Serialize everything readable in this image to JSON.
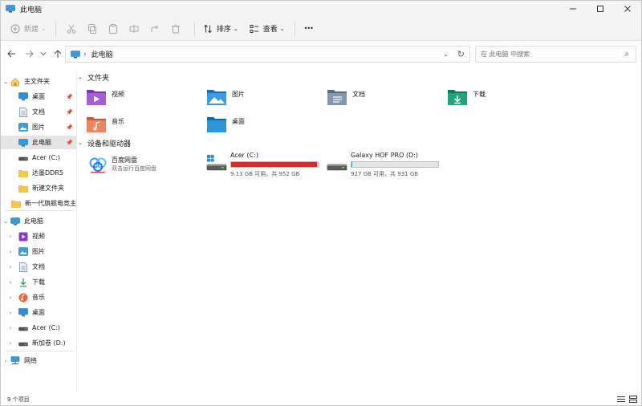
{
  "window": {
    "title": "此电脑"
  },
  "toolbar": {
    "new_label": "新建",
    "sort_label": "排序",
    "view_label": "查看",
    "more_label": "•••"
  },
  "address": {
    "path": "此电脑",
    "search_placeholder": "在 此电脑 中搜索"
  },
  "sidebar": {
    "home": "主文件夹",
    "quick": [
      {
        "label": "桌面",
        "icon": "desktop-icon",
        "pinned": true
      },
      {
        "label": "文档",
        "icon": "document-icon",
        "pinned": true
      },
      {
        "label": "图片",
        "icon": "picture-icon",
        "pinned": true
      },
      {
        "label": "此电脑",
        "icon": "pc-icon",
        "pinned": true
      },
      {
        "label": "Acer (C:)",
        "icon": "drive-icon",
        "pinned": false
      },
      {
        "label": "达墨DDR5",
        "icon": "folder-icon",
        "pinned": false
      },
      {
        "label": "新建文件夹",
        "icon": "folder-icon",
        "pinned": false
      },
      {
        "label": "新一代旗舰电竞主",
        "icon": "folder-icon",
        "pinned": false
      }
    ],
    "pc": "此电脑",
    "pc_children": [
      {
        "label": "视频",
        "icon": "video-icon"
      },
      {
        "label": "图片",
        "icon": "picture-icon"
      },
      {
        "label": "文档",
        "icon": "document-icon"
      },
      {
        "label": "下载",
        "icon": "download-icon"
      },
      {
        "label": "音乐",
        "icon": "music-icon"
      },
      {
        "label": "桌面",
        "icon": "desktop-icon"
      },
      {
        "label": "Acer (C:)",
        "icon": "drive-icon"
      },
      {
        "label": "新加卷 (D:)",
        "icon": "drive-icon"
      }
    ],
    "network": "网络"
  },
  "content": {
    "folders_header": "文件夹",
    "folders": [
      {
        "label": "视频",
        "icon": "video-folder-icon"
      },
      {
        "label": "图片",
        "icon": "picture-folder-icon"
      },
      {
        "label": "文档",
        "icon": "document-folder-icon"
      },
      {
        "label": "下载",
        "icon": "download-folder-icon"
      },
      {
        "label": "音乐",
        "icon": "music-folder-icon"
      },
      {
        "label": "桌面",
        "icon": "desktop-folder-icon"
      }
    ],
    "drives_header": "设备和驱动器",
    "cloud": {
      "label": "百度网盘",
      "sub": "双击运行百度网盘"
    },
    "drives": [
      {
        "label": "Acer (C:)",
        "free": "9.13 GB 可用，共 952 GB",
        "used_fraction": 0.99,
        "bar_color": "#da2b2b"
      },
      {
        "label": "Galaxy HOF PRO (D:)",
        "free": "927 GB 可用，共 931 GB",
        "used_fraction": 0.004,
        "bar_color": "#26a0da"
      }
    ]
  },
  "status": {
    "count": "9 个项目"
  },
  "colors": {
    "accent": "#0067c0",
    "selected": "#e5e5e5",
    "drive_full": "#da2b2b"
  }
}
